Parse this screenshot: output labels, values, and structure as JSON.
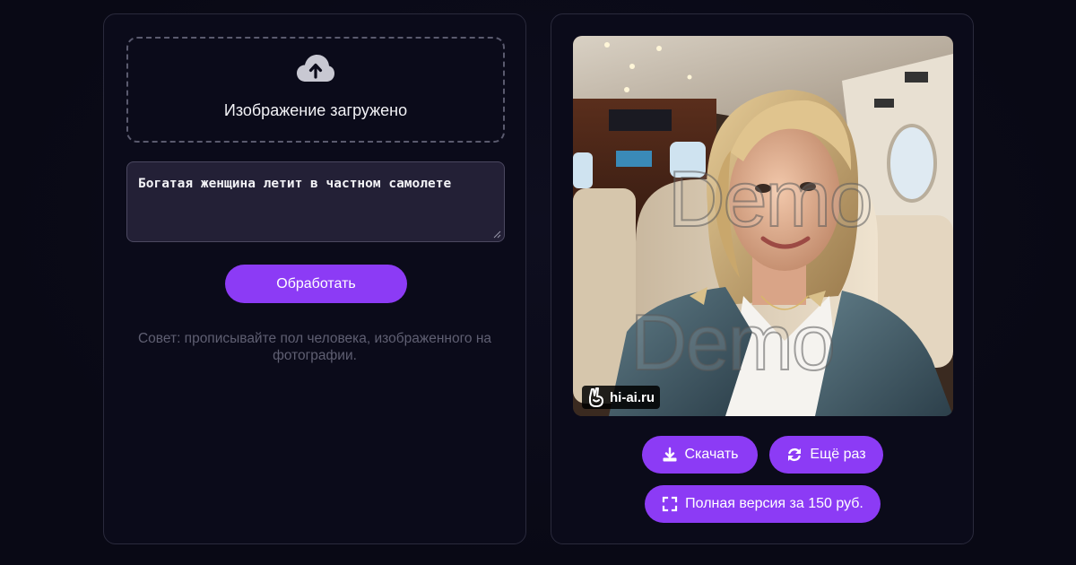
{
  "upload": {
    "status": "Изображение загружено",
    "icon": "cloud-upload-icon"
  },
  "prompt": {
    "value": "Богатая женщина летит в частном самолете"
  },
  "process_button": {
    "label": "Обработать"
  },
  "tip": {
    "text": "Совет: прописывайте пол человека, изображенного на фотографии."
  },
  "result": {
    "watermark_1": "Demo",
    "watermark_2": "Demo",
    "site_label": "hi-ai.ru"
  },
  "actions": {
    "download_label": "Скачать",
    "again_label": "Ещё раз",
    "full_version_label": "Полная версия за 150 руб."
  },
  "colors": {
    "accent": "#8c3bf5",
    "background": "#0b0b18",
    "panel": "#0b0b1a",
    "panel_border": "#2a2a3c",
    "tip_text": "#5f5f72"
  }
}
